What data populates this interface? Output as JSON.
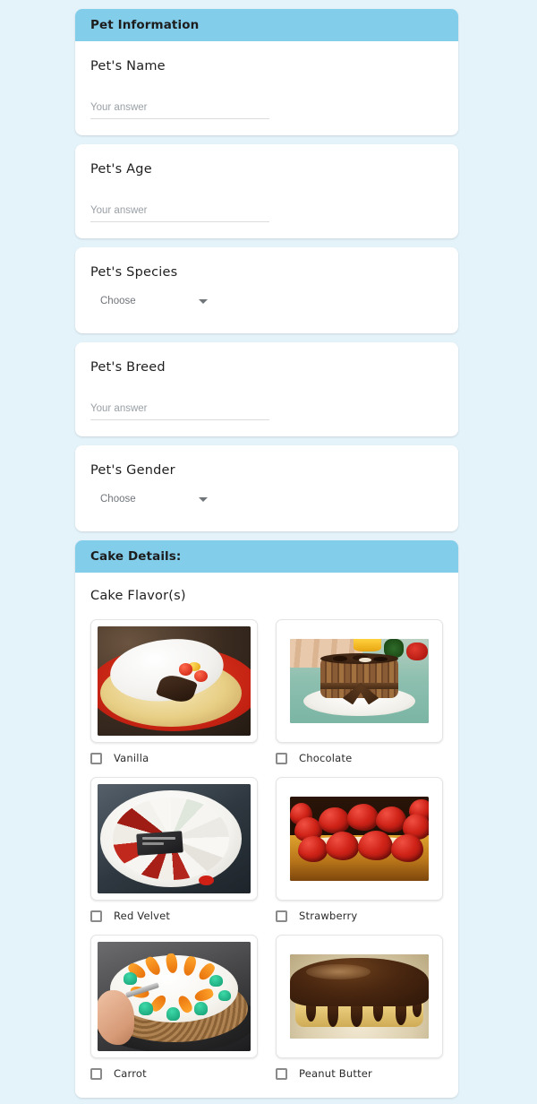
{
  "form": {
    "sections": [
      {
        "id": "pet-information",
        "header": "Pet Information",
        "questions": [
          {
            "id": "pets-name",
            "label": "Pet's Name",
            "type": "text",
            "value": "",
            "placeholder": "Your answer"
          },
          {
            "id": "pets-age",
            "label": "Pet's Age",
            "type": "text",
            "value": "",
            "placeholder": "Your answer"
          },
          {
            "id": "pets-species",
            "label": "Pet's Species",
            "type": "select",
            "selected": "Choose"
          },
          {
            "id": "pets-breed",
            "label": "Pet's Breed",
            "type": "text",
            "value": "",
            "placeholder": "Your answer"
          },
          {
            "id": "pets-gender",
            "label": "Pet's Gender",
            "type": "select",
            "selected": "Choose"
          }
        ]
      },
      {
        "id": "cake-details",
        "header": "Cake Details:",
        "questions": [
          {
            "id": "cake-flavors",
            "label": "Cake Flavor(s)",
            "type": "image-checkbox-grid",
            "options": [
              {
                "label": "Vanilla",
                "image": "vanilla-cake-photo",
                "checked": false
              },
              {
                "label": "Chocolate",
                "image": "chocolate-cake-photo",
                "checked": false
              },
              {
                "label": "Red Velvet",
                "image": "red-velvet-cake-photo",
                "checked": false
              },
              {
                "label": "Strawberry",
                "image": "strawberry-cake-photo",
                "checked": false
              },
              {
                "label": "Carrot",
                "image": "carrot-cake-photo",
                "checked": false
              },
              {
                "label": "Peanut Butter",
                "image": "peanut-butter-cake-photo",
                "checked": false
              }
            ]
          }
        ]
      }
    ]
  },
  "icons": {
    "dropdown_caret": "chevron-down-icon",
    "checkbox": "checkbox-unchecked-icon"
  },
  "colors": {
    "page_background": "#e4f2fa",
    "section_header": "#82cdea",
    "card_background": "#ffffff",
    "label_text": "#1f1f1f",
    "placeholder_text": "#9aa0a6",
    "input_underline": "#dcdcdc",
    "checkbox_border": "#8a8a8a"
  }
}
